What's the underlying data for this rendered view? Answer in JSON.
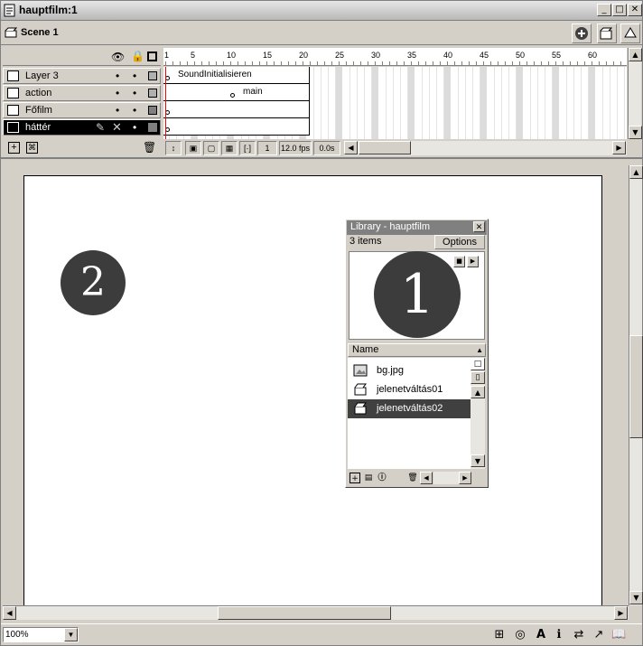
{
  "window": {
    "title": "hauptfilm:1"
  },
  "scene": {
    "label": "Scene 1"
  },
  "timeline": {
    "layers": [
      {
        "name": "Layer 3"
      },
      {
        "name": "action"
      },
      {
        "name": "Főfilm"
      },
      {
        "name": "háttér",
        "selected": true
      }
    ],
    "ruler_numbers": [
      "1",
      "5",
      "10",
      "15",
      "20",
      "25",
      "30",
      "35",
      "40",
      "45",
      "50",
      "55",
      "60"
    ],
    "frame_labels": {
      "layer3": "SoundInitialisieren",
      "action": "main"
    },
    "current_frame": "1",
    "fps": "12.0 fps",
    "time": "0.0s"
  },
  "stage": {
    "circle_1": "1",
    "circle_2": "2"
  },
  "library": {
    "title": "Library - hauptfilm",
    "count": "3 items",
    "options": "Options",
    "name_header": "Name",
    "items": [
      {
        "name": "bg.jpg",
        "icon": "bitmap-icon"
      },
      {
        "name": "jelenetváltás01",
        "icon": "movieclip-icon"
      },
      {
        "name": "jelenetváltás02",
        "icon": "movieclip-icon",
        "selected": true
      }
    ],
    "preview_symbol": "1"
  },
  "status": {
    "zoom": "100%"
  }
}
